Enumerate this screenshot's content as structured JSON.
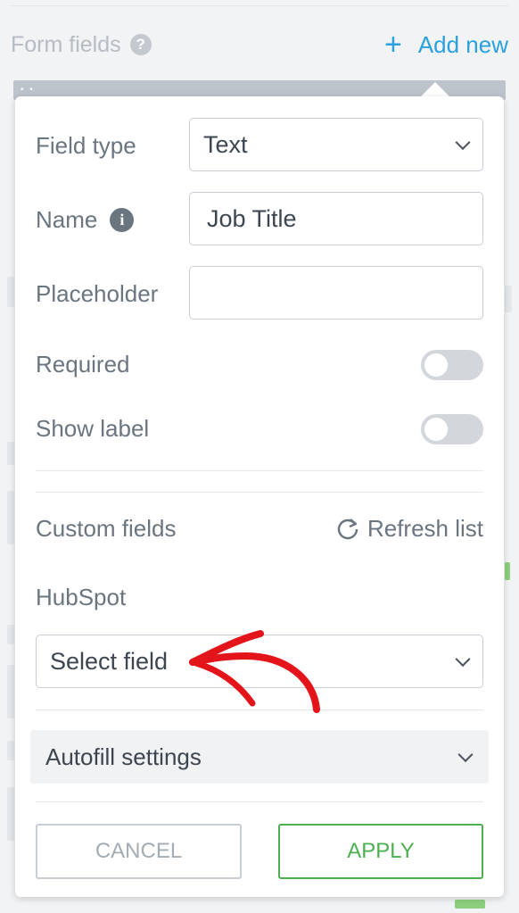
{
  "background": {
    "section_title": "Form fields",
    "help_icon": "?",
    "add_new_label": "Add new",
    "plus_icon": "+"
  },
  "popup": {
    "field_type": {
      "label": "Field type",
      "value": "Text"
    },
    "name": {
      "label": "Name",
      "info_icon": "i",
      "value": "Job Title"
    },
    "placeholder": {
      "label": "Placeholder",
      "value": ""
    },
    "required": {
      "label": "Required",
      "on": false
    },
    "show_label": {
      "label": "Show label",
      "on": false
    },
    "custom_fields": {
      "label": "Custom fields",
      "refresh_label": "Refresh list"
    },
    "hubspot": {
      "label": "HubSpot",
      "select_value": "Select field"
    },
    "autofill": {
      "label": "Autofill settings"
    },
    "buttons": {
      "cancel": "CANCEL",
      "apply": "APPLY"
    }
  },
  "colors": {
    "accent_blue": "#2aa1de",
    "apply_green": "#4caf50",
    "annotation_red": "#e3151b"
  },
  "icons": [
    "help-icon",
    "plus-icon",
    "info-icon",
    "chevron-down-icon",
    "refresh-icon",
    "annotation-arrow"
  ]
}
